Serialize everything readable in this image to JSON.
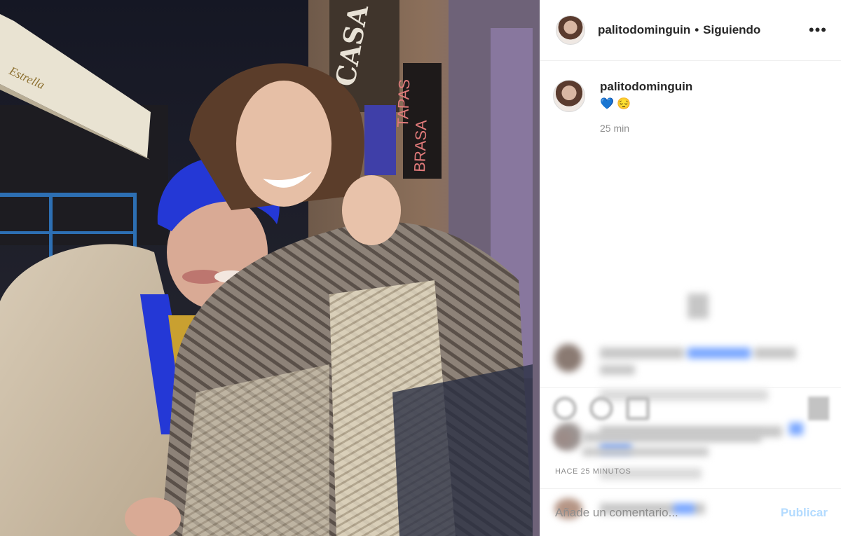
{
  "post": {
    "username": "palitodominguin",
    "follow_separator": "•",
    "follow_status": "Siguiendo",
    "more_icon": "ellipsis-icon"
  },
  "caption": {
    "username": "palitodominguin",
    "emoji_heart": "💙",
    "emoji_face": "😔",
    "time": "25 min"
  },
  "footer": {
    "posted_ago": "HACE 25 MINUTOS",
    "comment_placeholder": "Añade un comentario...",
    "publish_label": "Publicar"
  },
  "photo": {
    "sign_left": "Estrella",
    "sign_casa": "CASA",
    "sign_tapas": "TAPAS",
    "sign_brasa": "BRASA"
  },
  "colors": {
    "hair_blue": "#2438d6",
    "publish_disabled": "#b3dbff",
    "secondary_text": "#8e8e8e"
  }
}
